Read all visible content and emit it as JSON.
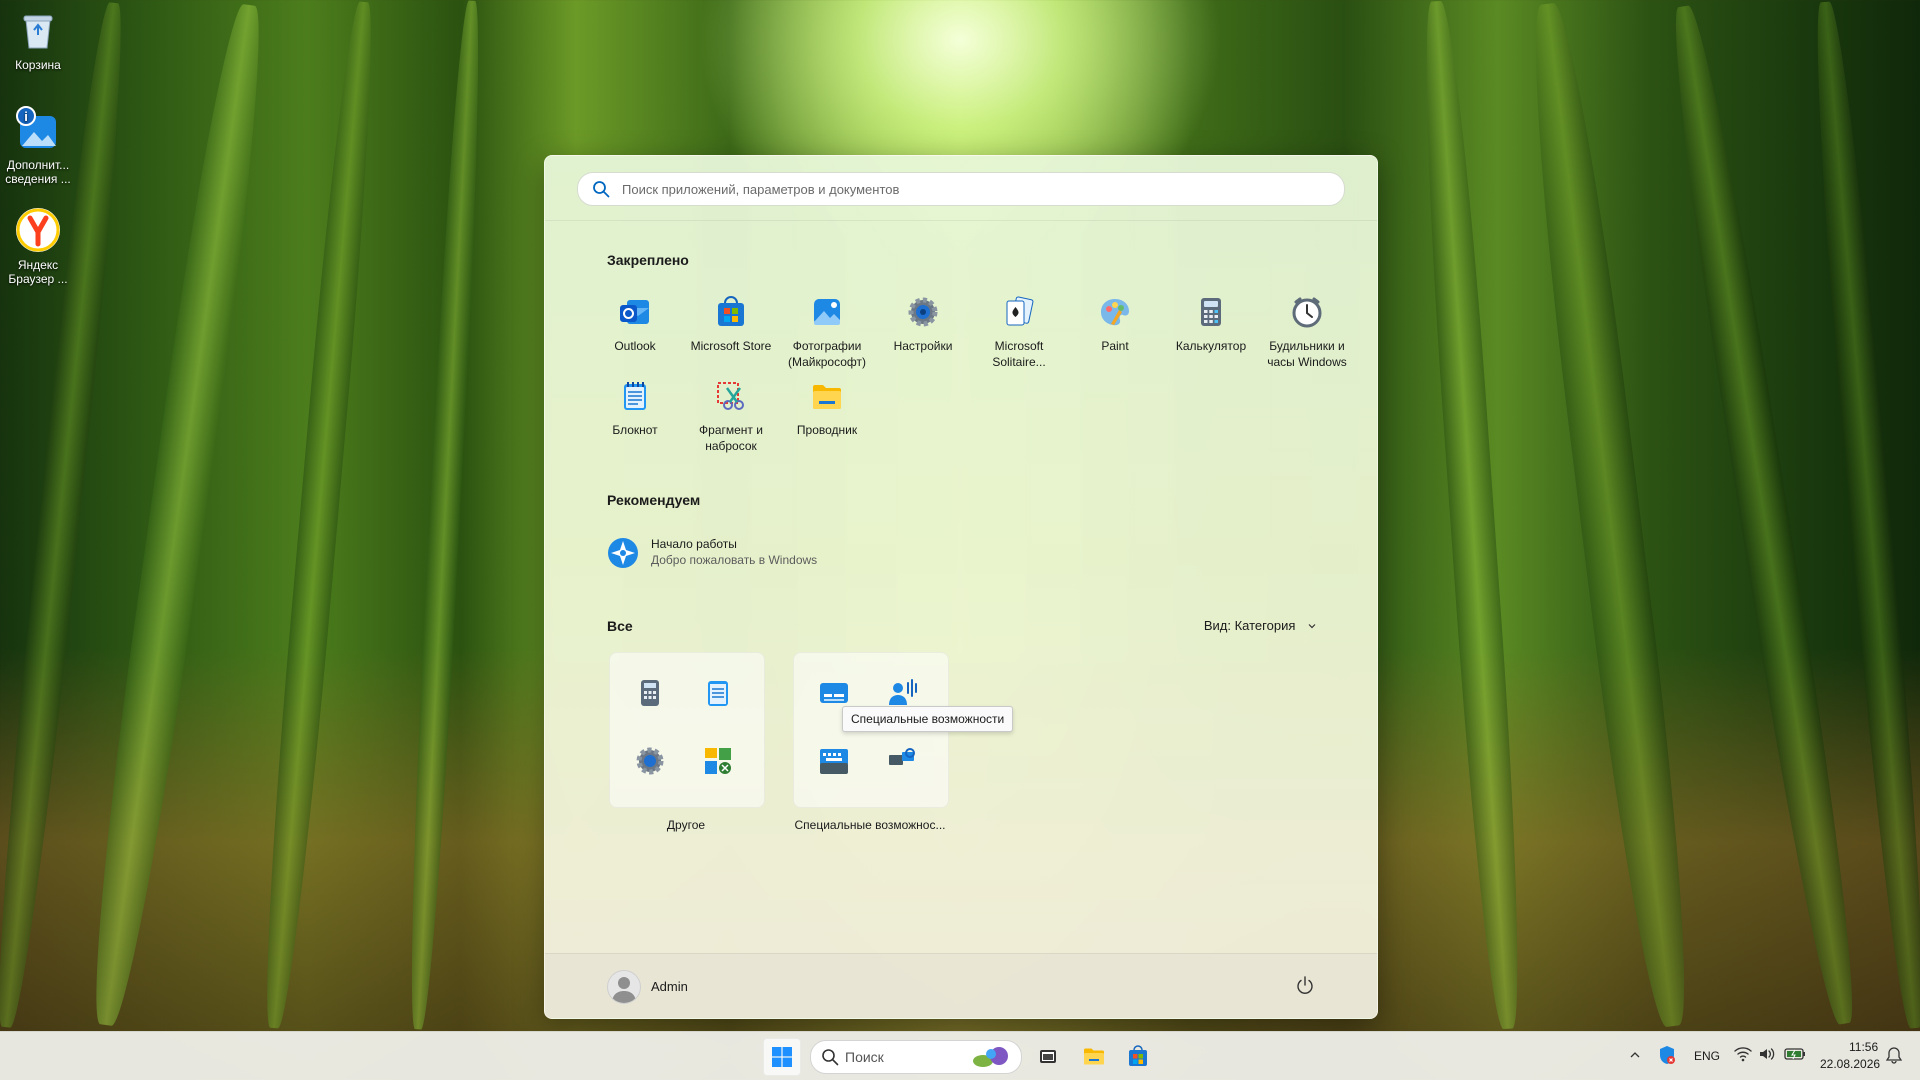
{
  "desktop": {
    "icons": [
      {
        "label": "Корзина",
        "icon": "recycle-bin-icon"
      },
      {
        "label": "Дополнит... сведения ...",
        "icon": "info-icon"
      },
      {
        "label": "Яндекс Браузер ...",
        "icon": "yandex-browser-icon"
      }
    ]
  },
  "start_menu": {
    "search_placeholder": "Поиск приложений, параметров и документов",
    "pinned_title": "Закреплено",
    "pinned": [
      {
        "label": "Outlook",
        "icon": "outlook-icon"
      },
      {
        "label": "Microsoft Store",
        "icon": "store-icon"
      },
      {
        "label": "Фотографии (Майкрософт)",
        "icon": "photos-icon"
      },
      {
        "label": "Настройки",
        "icon": "settings-gear-icon"
      },
      {
        "label": "Microsoft Solitaire...",
        "icon": "solitaire-icon"
      },
      {
        "label": "Paint",
        "icon": "paint-icon"
      },
      {
        "label": "Калькулятор",
        "icon": "calculator-icon"
      },
      {
        "label": "Будильники и часы Windows",
        "icon": "clock-icon"
      },
      {
        "label": "Блокнот",
        "icon": "notepad-icon"
      },
      {
        "label": "Фрагмент и набросок",
        "icon": "snipping-icon"
      },
      {
        "label": "Проводник",
        "icon": "folder-icon"
      }
    ],
    "recommended_title": "Рекомендуем",
    "recommended": [
      {
        "title": "Начало работы",
        "subtitle": "Добро пожаловать в Windows",
        "icon": "get-started-icon"
      }
    ],
    "all_title": "Все",
    "view_label": "Вид: Категория",
    "folders": [
      {
        "label": "Другое"
      },
      {
        "label": "Специальные возможнос..."
      }
    ],
    "tooltip": "Специальные возможности",
    "user_name": "Admin"
  },
  "taskbar": {
    "search_label": "Поиск",
    "language": "ENG",
    "time": "11:56",
    "date": "22.08.2026"
  },
  "colors": {
    "accent": "#0067c0",
    "windows_logo": "#1e90ff"
  }
}
